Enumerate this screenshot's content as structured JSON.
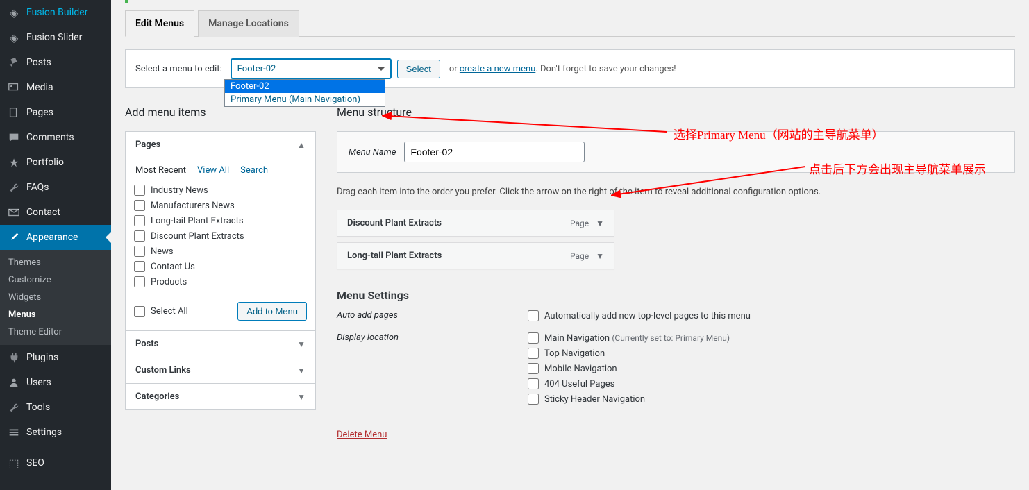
{
  "sidebar": {
    "items": [
      {
        "label": "Fusion Builder",
        "icon": "◈"
      },
      {
        "label": "Fusion Slider",
        "icon": "◈"
      },
      {
        "label": "Posts",
        "icon": "📌"
      },
      {
        "label": "Media",
        "icon": "🖼"
      },
      {
        "label": "Pages",
        "icon": "📄"
      },
      {
        "label": "Comments",
        "icon": "💬"
      },
      {
        "label": "Portfolio",
        "icon": "⭐"
      },
      {
        "label": "FAQs",
        "icon": "🔧"
      },
      {
        "label": "Contact",
        "icon": "✉"
      },
      {
        "label": "Appearance",
        "icon": "🖌"
      },
      {
        "label": "Plugins",
        "icon": "🔌"
      },
      {
        "label": "Users",
        "icon": "👤"
      },
      {
        "label": "Tools",
        "icon": "🔧"
      },
      {
        "label": "Settings",
        "icon": "⚙"
      },
      {
        "label": "SEO",
        "icon": "📊"
      }
    ],
    "sub_appearance": [
      "Themes",
      "Customize",
      "Widgets",
      "Menus",
      "Theme Editor"
    ]
  },
  "tabs": {
    "edit": "Edit Menus",
    "manage": "Manage Locations"
  },
  "select_bar": {
    "label": "Select a menu to edit:",
    "value": "Footer-02",
    "options": [
      "Footer-02",
      "Primary Menu (Main Navigation)"
    ],
    "select_btn": "Select",
    "or": "or",
    "create_link": "create a new menu",
    "tail": ". Don't forget to save your changes!"
  },
  "left": {
    "heading": "Add menu items",
    "acc_pages": "Pages",
    "tab_links": [
      "Most Recent",
      "View All",
      "Search"
    ],
    "page_items": [
      "Industry News",
      "Manufacturers News",
      "Long-tail Plant Extracts",
      "Discount Plant Extracts",
      "News",
      "Contact Us",
      "Products"
    ],
    "select_all": "Select All",
    "add_btn": "Add to Menu",
    "acc_posts": "Posts",
    "acc_custom": "Custom Links",
    "acc_cats": "Categories"
  },
  "right": {
    "heading": "Menu structure",
    "menu_name_label": "Menu Name",
    "menu_name_value": "Footer-02",
    "drag_hint": "Drag each item into the order you prefer. Click the arrow on the right of the item to reveal additional configuration options.",
    "items": [
      {
        "title": "Discount Plant Extracts",
        "type": "Page"
      },
      {
        "title": "Long-tail Plant Extracts",
        "type": "Page"
      }
    ],
    "settings_title": "Menu Settings",
    "auto_add_label": "Auto add pages",
    "auto_add_opt": "Automatically add new top-level pages to this menu",
    "display_label": "Display location",
    "locations": [
      {
        "label": "Main Navigation",
        "hint": "(Currently set to: Primary Menu)"
      },
      {
        "label": "Top Navigation",
        "hint": ""
      },
      {
        "label": "Mobile Navigation",
        "hint": ""
      },
      {
        "label": "404 Useful Pages",
        "hint": ""
      },
      {
        "label": "Sticky Header Navigation",
        "hint": ""
      }
    ],
    "delete": "Delete Menu"
  },
  "annotations": {
    "a1": "选择Primary Menu（网站的主导航菜单）",
    "a2": "点击后下方会出现主导航菜单展示"
  }
}
